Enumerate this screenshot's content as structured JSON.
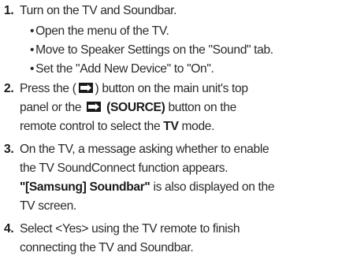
{
  "steps": [
    {
      "number": "1.",
      "text": "Turn on the TV and Soundbar.",
      "bullets": [
        "Open the menu of the TV.",
        "Move to Speaker Settings on the \"Sound\" tab.",
        "Set the \"Add New Device\" to \"On\"."
      ]
    },
    {
      "number": "2.",
      "line1_a": "Press the (",
      "line1_b": ") button on the main unit's top",
      "line2_a": "panel or the",
      "line2_bold": "(SOURCE)",
      "line2_b": "button on the",
      "line3_a": "remote control to select the",
      "line3_bold": "TV",
      "line3_b": "mode."
    },
    {
      "number": "3.",
      "line1": "On the TV, a message asking whether to enable",
      "line2": "the TV SoundConnect function appears.",
      "line3_bold": "\"[Samsung] Soundbar\"",
      "line3_rest": "is also displayed on the",
      "line4": "TV screen."
    },
    {
      "number": "4.",
      "line1": "Select <Yes> using the TV remote to finish",
      "line2": "connecting the TV and Soundbar."
    }
  ],
  "bullet_char": "•",
  "icons": {
    "source_icon": "source-input-icon"
  }
}
